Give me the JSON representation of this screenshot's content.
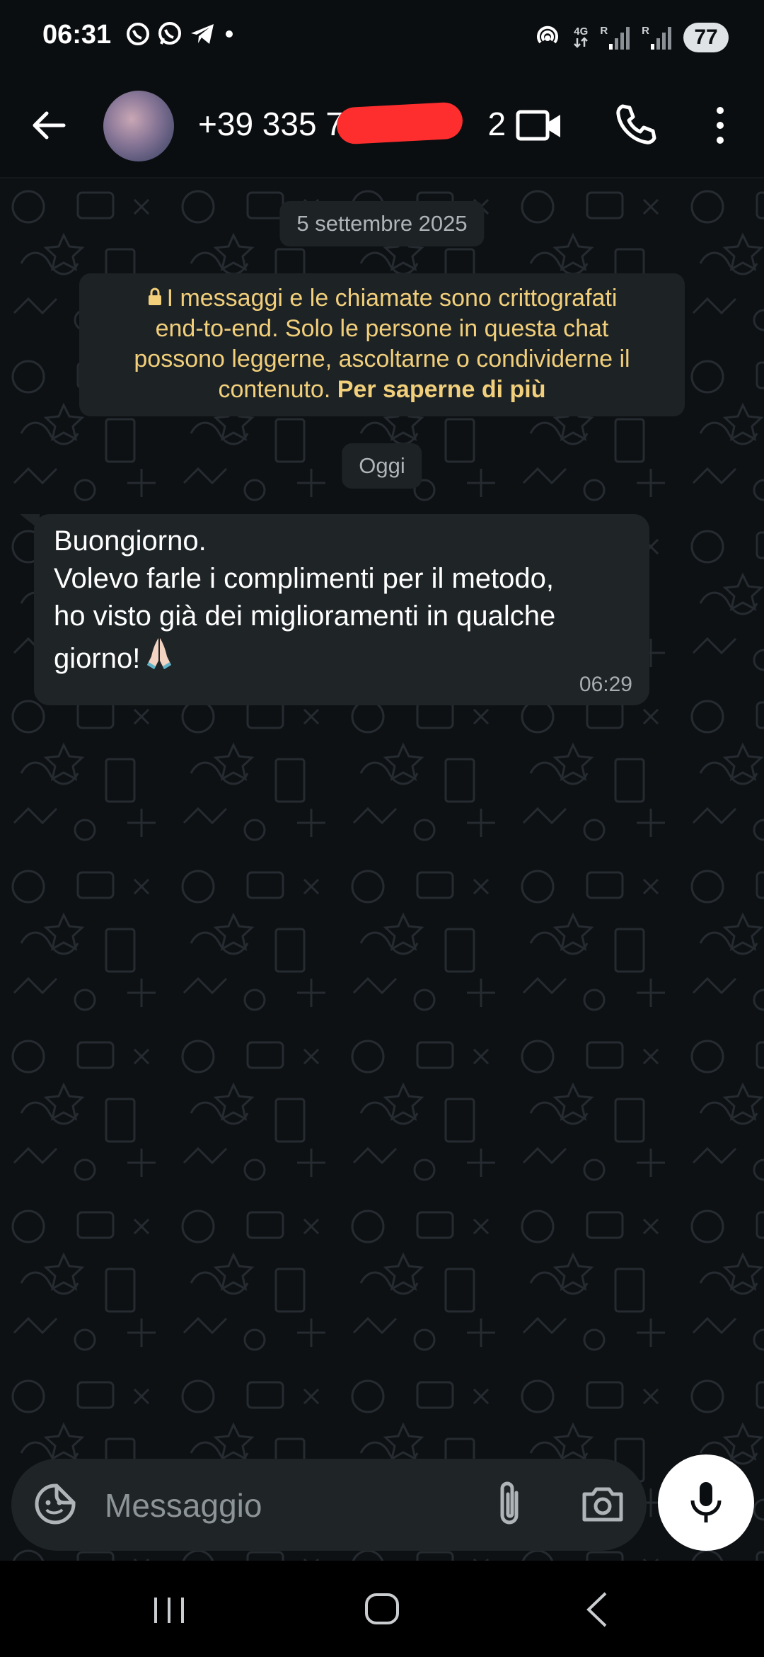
{
  "status_bar": {
    "time": "06:31",
    "notification_icons": [
      "viber-icon",
      "whatsapp-icon",
      "telegram-icon",
      "dot-icon"
    ],
    "network_labels": [
      "4G",
      "R",
      "R"
    ],
    "battery": "77"
  },
  "header": {
    "contact_name": "+39 335 71",
    "contact_name_suffix": "2"
  },
  "chat": {
    "date_label": "5 settembre 2025",
    "encryption_notice": {
      "lines": [
        "I messaggi e le chiamate sono crittografati",
        "end-to-end. Solo le persone in questa chat",
        "possono leggerne, ascoltarne o condividerne il",
        "contenuto. "
      ],
      "link": "Per saperne di più"
    },
    "today_label": "Oggi",
    "messages": [
      {
        "lines": [
          "Buongiorno.",
          "Volevo farle i complimenti per il metodo,",
          "ho visto già dei miglioramenti in qualche",
          "giorno!"
        ],
        "emoji": "folded-hands",
        "time": "06:29"
      }
    ]
  },
  "composer": {
    "placeholder": "Messaggio"
  },
  "colors": {
    "background": "#0b0e11",
    "bubble": "#1f2427",
    "notice_text": "#f1cf7b",
    "redaction": "#ff2e2e"
  }
}
